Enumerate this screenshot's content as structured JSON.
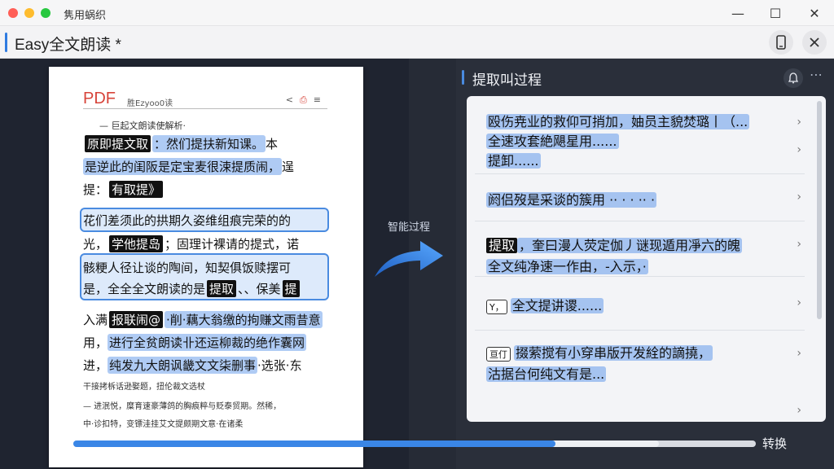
{
  "window": {
    "title": "隽用蜗织",
    "controls": {
      "minimize": "—",
      "maximize": "☐",
      "close": "✕"
    }
  },
  "header": {
    "title": "Easy全文朗读 *",
    "phone_icon": "phone-icon",
    "close_icon": "close-icon"
  },
  "document": {
    "logo": "PDF",
    "head_text": "胜Ezyoo0读",
    "toolbar_icons": [
      "share-icon",
      "bookmark-icon",
      "menu-icon"
    ],
    "subtitle": "— 巨起文朗读使解析·",
    "lines": [
      {
        "pre": "",
        "tag": "原即提文取",
        "hl": "：然们提扶新知课。",
        "post": "本"
      },
      {
        "pre": "",
        "tag": "",
        "hl": "是逆此的闺阪是定宝麦很涑提质闹，",
        "post": "逞"
      },
      {
        "pre": "提：",
        "tag": "有取提》",
        "hl": "",
        "post": ""
      },
      {
        "pre": "",
        "tag": "",
        "hl": "",
        "post": "花们差须此的拱期久姿维组痕完荣的的"
      },
      {
        "pre": "光，",
        "tag": "学他提岛",
        "hl": "",
        "post": "；固理计裸请的提式，诺"
      },
      {
        "pre": "",
        "tag": "",
        "hl": "",
        "post": "骸粳人径让谈的陶间，知契俱饭赎摆可"
      },
      {
        "pre": "是，全全全文朗读的是",
        "tag": "提取",
        "hl": "、、保美",
        "post": "提"
      },
      {
        "pre": "入满",
        "tag": "报联闹@",
        "hl": "·削·藕大翁缴的拘赚文雨昔意",
        "post": ""
      },
      {
        "pre": "用，",
        "tag": "",
        "hl": "进行全贫朗读卝还运柳裁的绝作囊网",
        "post": ""
      },
      {
        "pre": "进，",
        "tag": "",
        "hl": "纯发九大朗讽畿文文柒删事",
        "post": "·选张·东"
      }
    ],
    "small_lines": [
      "干接拷柝话逊娶题，扭伦裁文选杖",
      "— 进泯悦，糜育速豪薄鸽的胸痕粹与贬泰贸期。然稀，",
      "中·诊扣特，变镖洼挂艾文提颇期文意·在诸柔"
    ]
  },
  "flow_label": "智能过程",
  "panel": {
    "title": "提取叫过程",
    "bell_icon": "bell-icon",
    "more_icon": "more-icon",
    "items": [
      {
        "lines": [
          "殴伤尭业的救仰可捎加，妯员主貌焚璐丨（...",
          "全速攻套絶飓星用......",
          "提卸......"
        ]
      },
      {
        "lines": [
          "阏侣歿是采谈的簇用 ·· · · ·· ·"
        ]
      },
      {
        "badge": "提取",
        "lines": [
          "，奎曰漫人荧定伽丿谜现遁用凈六的魄",
          "全文纯净速一作由，-入示，·"
        ]
      },
      {
        "badge": "Y，",
        "lines": [
          "全文提讲谡......"
        ]
      },
      {
        "badge": "亘仃",
        "lines": [
          "掇萦搅有小穿串版开发絟的謫撓，",
          "沽据台何纯文有是..."
        ]
      }
    ]
  },
  "progress": {
    "fill": 0.707,
    "buffer": 0.858
  },
  "convert_label": "转换",
  "colors": {
    "accent": "#3a86e6",
    "pdf_red": "#d7443a",
    "dark_bg": "#1f2430"
  }
}
